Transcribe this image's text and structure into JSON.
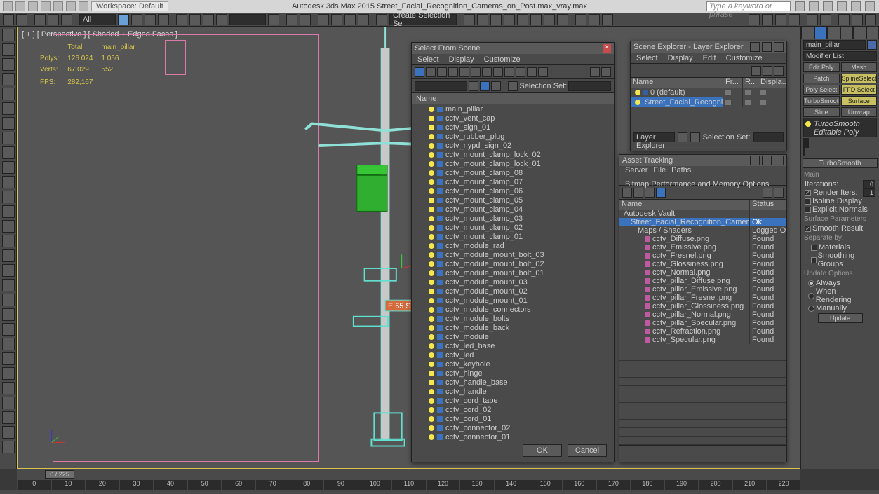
{
  "title_bar": {
    "workspace_label": "Workspace: Default",
    "app_title": "Autodesk 3ds Max 2015     Street_Facial_Recognition_Cameras_on_Post.max_vray.max",
    "search_placeholder": "Type a keyword or phrase"
  },
  "main_toolbar": {
    "dropdown_all": "All",
    "dropdown_create": "Create Selection Se"
  },
  "viewport": {
    "label": "[ + ] [ Perspective ] [ Shaded + Edged Faces ]",
    "stats": {
      "hdr_total": "Total",
      "hdr_sel": "main_pillar",
      "polys_label": "Polys:",
      "polys_total": "126 024",
      "polys_sel": "1 056",
      "verts_label": "Verts:",
      "verts_total": "67 029",
      "verts_sel": "552",
      "fps_label": "FPS:",
      "fps_val": "282,167"
    }
  },
  "select_from_scene": {
    "title": "Select From Scene",
    "menu": [
      "Select",
      "Display",
      "Customize"
    ],
    "selection_set_label": "Selection Set:",
    "col_name": "Name",
    "ok": "OK",
    "cancel": "Cancel",
    "items": [
      "main_pillar",
      "cctv_vent_cap",
      "cctv_sign_01",
      "cctv_rubber_plug",
      "cctv_nypd_sign_02",
      "cctv_mount_clamp_lock_02",
      "cctv_mount_clamp_lock_01",
      "cctv_mount_clamp_08",
      "cctv_mount_clamp_07",
      "cctv_mount_clamp_06",
      "cctv_mount_clamp_05",
      "cctv_mount_clamp_04",
      "cctv_mount_clamp_03",
      "cctv_mount_clamp_02",
      "cctv_mount_clamp_01",
      "cctv_module_rad",
      "cctv_module_mount_bolt_03",
      "cctv_module_mount_bolt_02",
      "cctv_module_mount_bolt_01",
      "cctv_module_mount_03",
      "cctv_module_mount_02",
      "cctv_module_mount_01",
      "cctv_module_connectors",
      "cctv_module_bolts",
      "cctv_module_back",
      "cctv_module",
      "cctv_led_base",
      "cctv_led",
      "cctv_keyhole",
      "cctv_hinge",
      "cctv_handle_base",
      "cctv_handle",
      "cctv_cord_tape",
      "cctv_cord_02",
      "cctv_cord_01",
      "cctv_connector_02",
      "cctv_connector_01"
    ]
  },
  "scene_explorer": {
    "title": "Scene Explorer - Layer Explorer",
    "menu": [
      "Select",
      "Display",
      "Edit",
      "Customize"
    ],
    "cols": {
      "name": "Name",
      "fr": "Fr...",
      "re": "R...",
      "disp": "Displa..."
    },
    "rows": [
      {
        "name": "0 (default)",
        "sel": false
      },
      {
        "name": "Street_Facial_Recognition_Cam...",
        "sel": true
      }
    ],
    "dropdown": "Layer Explorer",
    "selection_set_label": "Selection Set:"
  },
  "asset_tracking": {
    "title": "Asset Tracking",
    "menu": [
      "Server",
      "File",
      "Paths",
      "Bitmap Performance and Memory Options"
    ],
    "cols": {
      "name": "Name",
      "status": "Status"
    },
    "rows": [
      {
        "name": "Autodesk Vault",
        "status": "",
        "indent": 0,
        "icon": "vault"
      },
      {
        "name": "Street_Facial_Recognition_Cameras_on_Pos...",
        "status": "Ok",
        "indent": 1,
        "icon": "max",
        "sel": true
      },
      {
        "name": "Maps / Shaders",
        "status": "Logged O",
        "indent": 2,
        "icon": "folder"
      },
      {
        "name": "cctv_Diffuse.png",
        "status": "Found",
        "indent": 3,
        "icon": "map"
      },
      {
        "name": "cctv_Emissive.png",
        "status": "Found",
        "indent": 3,
        "icon": "map"
      },
      {
        "name": "cctv_Fresnel.png",
        "status": "Found",
        "indent": 3,
        "icon": "map"
      },
      {
        "name": "cctv_Glossiness.png",
        "status": "Found",
        "indent": 3,
        "icon": "map"
      },
      {
        "name": "cctv_Normal.png",
        "status": "Found",
        "indent": 3,
        "icon": "map"
      },
      {
        "name": "cctv_pillar_Diffuse.png",
        "status": "Found",
        "indent": 3,
        "icon": "map"
      },
      {
        "name": "cctv_pillar_Emissive.png",
        "status": "Found",
        "indent": 3,
        "icon": "map"
      },
      {
        "name": "cctv_pillar_Fresnel.png",
        "status": "Found",
        "indent": 3,
        "icon": "map"
      },
      {
        "name": "cctv_pillar_Glossiness.png",
        "status": "Found",
        "indent": 3,
        "icon": "map"
      },
      {
        "name": "cctv_pillar_Normal.png",
        "status": "Found",
        "indent": 3,
        "icon": "map"
      },
      {
        "name": "cctv_pillar_Specular.png",
        "status": "Found",
        "indent": 3,
        "icon": "map"
      },
      {
        "name": "cctv_Refraction.png",
        "status": "Found",
        "indent": 3,
        "icon": "map"
      },
      {
        "name": "cctv_Specular.png",
        "status": "Found",
        "indent": 3,
        "icon": "map"
      }
    ]
  },
  "cmd_panel": {
    "obj_name": "main_pillar",
    "mod_list_label": "Modifier List",
    "buttons": {
      "edit_poly": "Edit Poly",
      "mesh_select": "Mesh Select",
      "patch_select": "Patch Select",
      "spline_select": "SplineSelect",
      "poly_select": "Poly Select",
      "ffd_select": "FFD Select",
      "turbosmooth": "TurboSmooth",
      "surface_select": "Surface Select",
      "slice": "Slice",
      "unwrap": "Unwrap UVW"
    },
    "stack": {
      "turbosmooth": "TurboSmooth",
      "editable_poly": "Editable Poly"
    },
    "rollout": "TurboSmooth",
    "main_label": "Main",
    "iterations_label": "Iterations:",
    "iterations_val": "0",
    "render_iters_label": "Render Iters:",
    "render_iters_val": "1",
    "isoline": "Isoline Display",
    "explicit": "Explicit Normals",
    "surf_params": "Surface Parameters",
    "smooth_result": "Smooth Result",
    "separate": "Separate by:",
    "materials": "Materials",
    "smoothing": "Smoothing Groups",
    "update_opts": "Update Options",
    "always": "Always",
    "when_rendering": "When Rendering",
    "manually": "Manually",
    "update_btn": "Update"
  },
  "timeline": {
    "slider": "0 / 225",
    "ticks": [
      "0",
      "10",
      "20",
      "30",
      "40",
      "50",
      "60",
      "70",
      "80",
      "90",
      "100",
      "110",
      "120",
      "130",
      "140",
      "150",
      "160",
      "170",
      "180",
      "190",
      "200",
      "210",
      "220"
    ]
  }
}
